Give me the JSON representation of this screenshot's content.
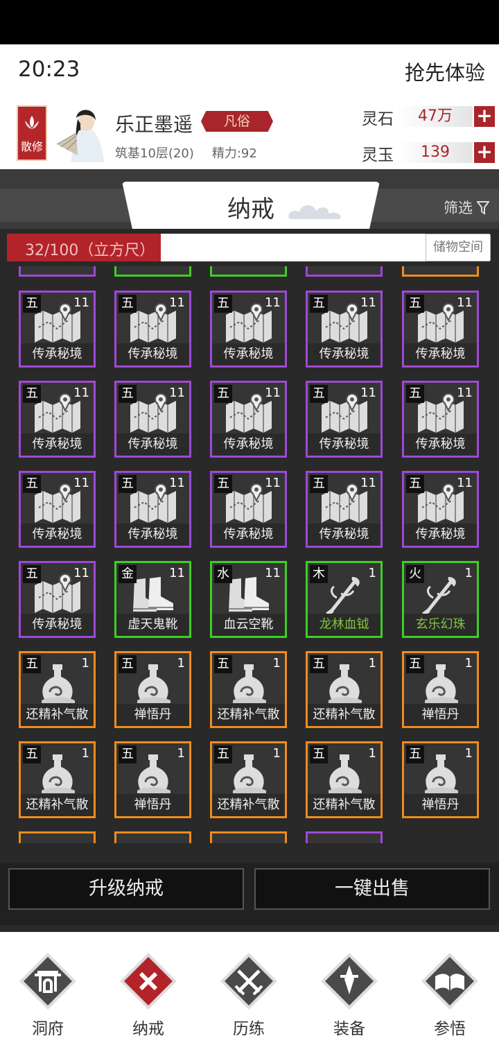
{
  "status": {
    "time": "20:23",
    "early_access": "抢先体验"
  },
  "player": {
    "sect_label": "散修",
    "name": "乐正墨遥",
    "rank": "凡俗",
    "cultivation": "筑基10层(20)",
    "energy": "精力:92",
    "currencies": [
      {
        "label": "灵石",
        "value": "47万"
      },
      {
        "label": "灵玉",
        "value": "139"
      }
    ]
  },
  "panel": {
    "title": "纳戒",
    "filter_label": "筛选",
    "capacity_text": "32/100（立方尺）",
    "capacity_fraction": 0.32,
    "storage_button": "储物空间"
  },
  "items": [
    {
      "el": "五",
      "count": "11",
      "name": "传承秘境",
      "quality": "purple",
      "icon": "map-scroll-icon"
    },
    {
      "el": "五",
      "count": "11",
      "name": "传承秘境",
      "quality": "purple",
      "icon": "map-scroll-icon"
    },
    {
      "el": "五",
      "count": "11",
      "name": "传承秘境",
      "quality": "purple",
      "icon": "map-scroll-icon"
    },
    {
      "el": "五",
      "count": "11",
      "name": "传承秘境",
      "quality": "purple",
      "icon": "map-scroll-icon"
    },
    {
      "el": "五",
      "count": "11",
      "name": "传承秘境",
      "quality": "purple",
      "icon": "map-scroll-icon"
    },
    {
      "el": "五",
      "count": "11",
      "name": "传承秘境",
      "quality": "purple",
      "icon": "map-scroll-icon"
    },
    {
      "el": "五",
      "count": "11",
      "name": "传承秘境",
      "quality": "purple",
      "icon": "map-scroll-icon"
    },
    {
      "el": "五",
      "count": "11",
      "name": "传承秘境",
      "quality": "purple",
      "icon": "map-scroll-icon"
    },
    {
      "el": "五",
      "count": "11",
      "name": "传承秘境",
      "quality": "purple",
      "icon": "map-scroll-icon"
    },
    {
      "el": "五",
      "count": "11",
      "name": "传承秘境",
      "quality": "purple",
      "icon": "map-scroll-icon"
    },
    {
      "el": "五",
      "count": "11",
      "name": "传承秘境",
      "quality": "purple",
      "icon": "map-scroll-icon"
    },
    {
      "el": "五",
      "count": "11",
      "name": "传承秘境",
      "quality": "purple",
      "icon": "map-scroll-icon"
    },
    {
      "el": "五",
      "count": "11",
      "name": "传承秘境",
      "quality": "purple",
      "icon": "map-scroll-icon"
    },
    {
      "el": "五",
      "count": "11",
      "name": "传承秘境",
      "quality": "purple",
      "icon": "map-scroll-icon"
    },
    {
      "el": "五",
      "count": "11",
      "name": "传承秘境",
      "quality": "purple",
      "icon": "map-scroll-icon"
    },
    {
      "el": "五",
      "count": "11",
      "name": "传承秘境",
      "quality": "purple",
      "icon": "map-scroll-icon"
    },
    {
      "el": "金",
      "count": "11",
      "name": "虚天鬼靴",
      "quality": "green",
      "icon": "boots-icon"
    },
    {
      "el": "水",
      "count": "11",
      "name": "血云空靴",
      "quality": "green",
      "icon": "boots-icon"
    },
    {
      "el": "木",
      "count": "1",
      "name": "龙林血钺",
      "quality": "green",
      "icon": "weapon-icon",
      "name_green": true
    },
    {
      "el": "火",
      "count": "1",
      "name": "玄乐幻珠",
      "quality": "green",
      "icon": "weapon-icon",
      "name_green": true
    },
    {
      "el": "五",
      "count": "1",
      "name": "还精补气散",
      "quality": "orange",
      "icon": "pill-bottle-icon"
    },
    {
      "el": "五",
      "count": "1",
      "name": "禅悟丹",
      "quality": "orange",
      "icon": "pill-bottle-icon"
    },
    {
      "el": "五",
      "count": "1",
      "name": "还精补气散",
      "quality": "orange",
      "icon": "pill-bottle-icon"
    },
    {
      "el": "五",
      "count": "1",
      "name": "还精补气散",
      "quality": "orange",
      "icon": "pill-bottle-icon"
    },
    {
      "el": "五",
      "count": "1",
      "name": "禅悟丹",
      "quality": "orange",
      "icon": "pill-bottle-icon"
    },
    {
      "el": "五",
      "count": "1",
      "name": "还精补气散",
      "quality": "orange",
      "icon": "pill-bottle-icon"
    },
    {
      "el": "五",
      "count": "1",
      "name": "禅悟丹",
      "quality": "orange",
      "icon": "pill-bottle-icon"
    },
    {
      "el": "五",
      "count": "1",
      "name": "还精补气散",
      "quality": "orange",
      "icon": "pill-bottle-icon"
    },
    {
      "el": "五",
      "count": "1",
      "name": "还精补气散",
      "quality": "orange",
      "icon": "pill-bottle-icon"
    },
    {
      "el": "五",
      "count": "1",
      "name": "禅悟丹",
      "quality": "orange",
      "icon": "pill-bottle-icon"
    }
  ],
  "partial_top_row": [
    {
      "quality": "purple"
    },
    {
      "quality": "green"
    },
    {
      "quality": "green"
    },
    {
      "quality": "purple"
    },
    {
      "quality": "orange"
    }
  ],
  "partial_bottom_row": [
    {
      "quality": "orange"
    },
    {
      "quality": "orange"
    },
    {
      "quality": "orange"
    },
    {
      "quality": "purple"
    }
  ],
  "actions": {
    "upgrade": "升级纳戒",
    "sell_all": "一键出售"
  },
  "nav": [
    {
      "label": "洞府",
      "icon": "cave-dwelling-icon",
      "active": false
    },
    {
      "label": "纳戒",
      "icon": "ring-storage-icon",
      "active": true
    },
    {
      "label": "历练",
      "icon": "crossed-swords-icon",
      "active": false
    },
    {
      "label": "装备",
      "icon": "equipment-sword-icon",
      "active": false
    },
    {
      "label": "参悟",
      "icon": "book-icon",
      "active": false
    }
  ],
  "colors": {
    "purple": "#a048d8",
    "green": "#3fce26",
    "orange": "#f08c1c",
    "accent_red": "#b3232a"
  }
}
